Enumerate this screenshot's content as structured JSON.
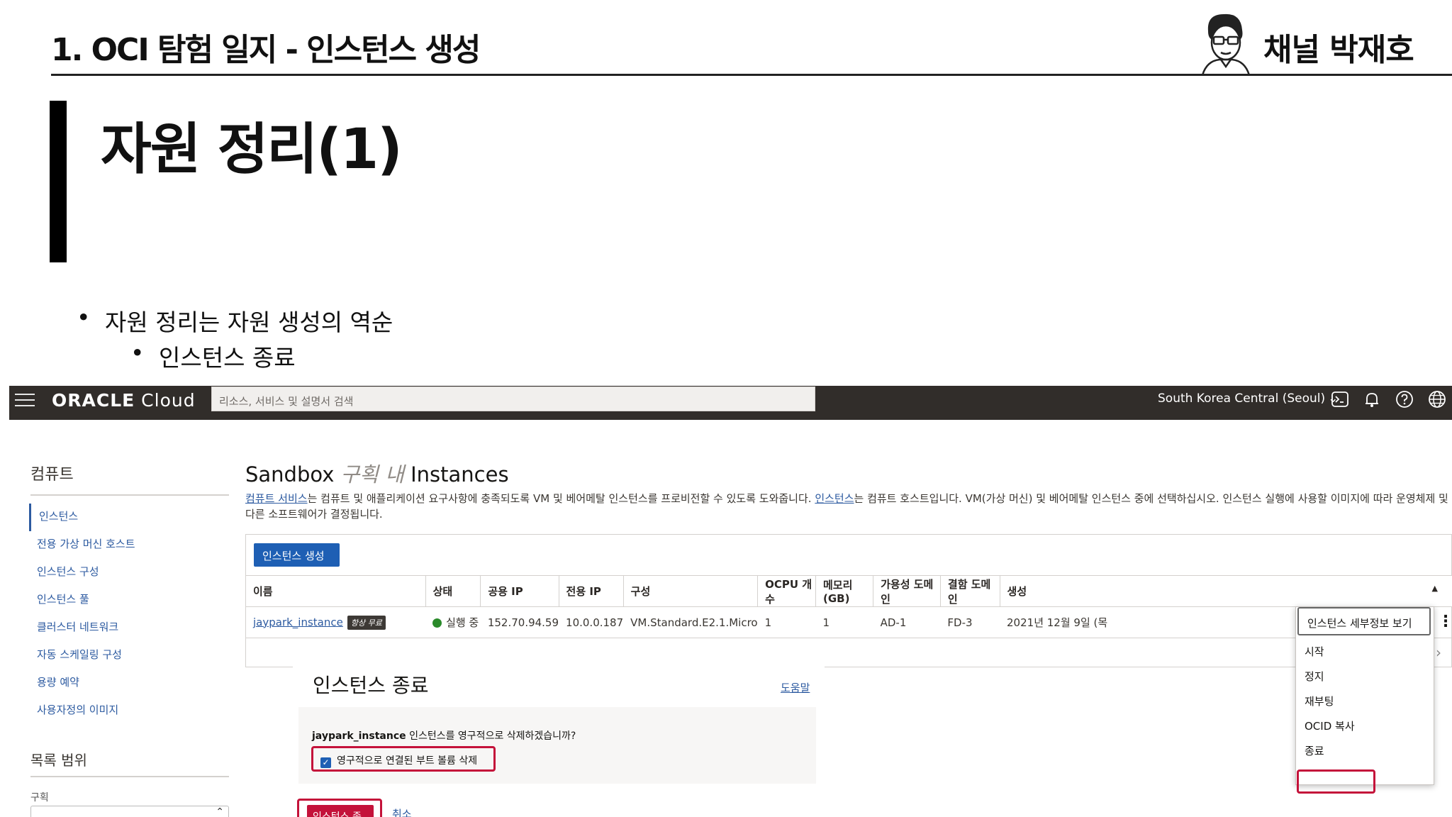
{
  "slide": {
    "header_title": "1. OCI 탐험 일지 - 인스턴스 생성",
    "brand_name": "채널 박재호",
    "section_title": "자원 정리(1)",
    "bullets": [
      "자원 정리는 자원 생성의 역순",
      "인스턴스 종료"
    ],
    "bullet_mark": "•"
  },
  "console": {
    "logo_brand": "ORACLE",
    "logo_product": "Cloud",
    "search_placeholder": "리소스, 서비스 및 설명서 검색",
    "region": "South Korea Central (Seoul)",
    "sidebar": {
      "heading": "컴퓨트",
      "items": [
        "인스턴스",
        "전용 가상 머신 호스트",
        "인스턴스 구성",
        "인스턴스 풀",
        "클러스터 네트워크",
        "자동 스케일링 구성",
        "용량 예약",
        "사용자정의 이미지"
      ],
      "scope_heading": "목록 범위",
      "compartment_label": "구획"
    },
    "page": {
      "title_prefix": "Sandbox",
      "title_italic": "구획 내",
      "title_suffix": "Instances",
      "desc_link1": "컴퓨트 서비스",
      "desc_text1": "는 컴퓨트 및 애플리케이션 요구사항에 충족되도록 VM 및 베어메탈 인스턴스를 프로비전할 수 있도록 도와줍니다. ",
      "desc_link2": "인스턴스",
      "desc_text2": "는 컴퓨트 호스트입니다. VM(가상 머신) 및 베어메탈 인스턴스 중에 선택하십시오. 인스턴스 실행에 사용할 이미지에 따라 운영체제 및 다른 소프트웨어가 결정됩니다.",
      "create_button": "인스턴스 생성"
    },
    "table": {
      "headers": [
        "이름",
        "상태",
        "공용 IP",
        "전용 IP",
        "구성",
        "OCPU 개수",
        "메모리(GB)",
        "가용성 도메인",
        "결함 도메인",
        "생성"
      ],
      "row": {
        "name": "jaypark_instance",
        "badge": "항상 무료",
        "status": "실행 중",
        "public_ip": "152.70.94.59",
        "private_ip": "10.0.0.187",
        "shape": "VM.Standard.E2.1.Micro",
        "ocpu": "1",
        "memory": "1",
        "ad": "AD-1",
        "fd": "FD-3",
        "created": "2021년 12월 9일 (목"
      },
      "status_color": "#2a8a2a"
    },
    "action_menu": [
      "인스턴스 세부정보 보기",
      "시작",
      "정지",
      "재부팅",
      "OCID 복사",
      "종료"
    ],
    "dialog": {
      "title": "인스턴스 종료",
      "help": "도움말",
      "question_name": "jaypark_instance",
      "question_text": " 인스턴스를 영구적으로 삭제하겠습니까?",
      "checkbox_label": "영구적으로 연결된 부트 볼륨 삭제",
      "checkbox_checked": true,
      "terminate_button": "인스턴스 종료",
      "cancel": "취소"
    },
    "colors": {
      "topbar": "#312d2a",
      "primary_button": "#1e5fb4",
      "danger": "#c4123a",
      "link": "#2c5aa0"
    }
  }
}
